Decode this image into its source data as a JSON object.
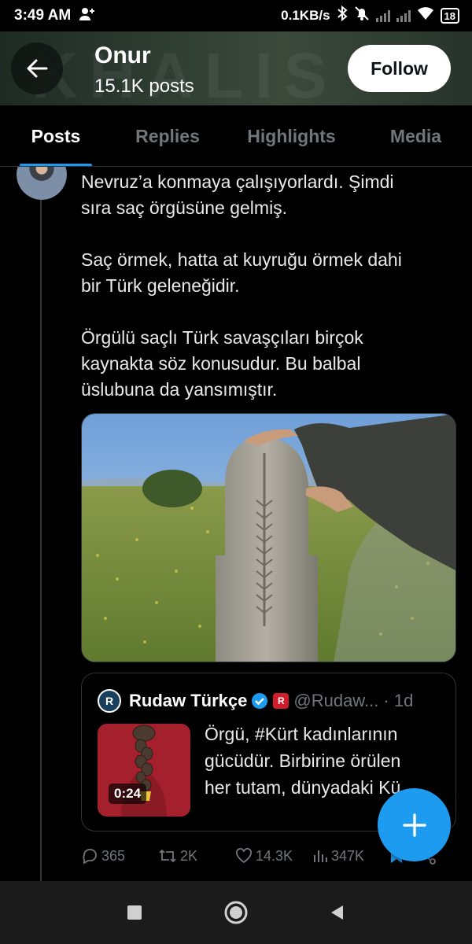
{
  "status_bar": {
    "time": "3:49 AM",
    "network_speed": "0.1KB/s",
    "battery": "18",
    "icons": [
      "person-add-icon",
      "bluetooth-icon",
      "mute-bell-icon",
      "signal-icon",
      "wifi-icon",
      "battery-icon"
    ]
  },
  "header": {
    "title": "Onur",
    "subtitle": "15.1K posts",
    "follow_label": "Follow",
    "banner_text": "KHALIS"
  },
  "tabs": [
    {
      "label": "Posts",
      "active": true
    },
    {
      "label": "Replies",
      "active": false
    },
    {
      "label": "Highlights",
      "active": false
    },
    {
      "label": "Media",
      "active": false
    }
  ],
  "tweet": {
    "paragraphs": [
      [
        "Nevruz’a konmaya çalışıyorlardı. Şimdi",
        "sıra saç örgüsüne gelmiş."
      ],
      [
        "Saç örmek, hatta at kuyruğu örmek dahi",
        "bir Türk geleneğidir."
      ],
      [
        "Örgülü saçlı Türk savaşçıları birçok",
        "kaynakta söz konusudur. Bu balbal",
        "üslubuna da yansımıştır."
      ]
    ]
  },
  "quote": {
    "name": "Rudaw Türkçe",
    "handle": "@Rudaw... · 1d",
    "logo_text": "R",
    "video_duration": "0:24",
    "text_lines": [
      "Örgü, #Kürt kadınlarının",
      "gücüdür. Birbirine örülen",
      "her tutam, dünyadaki Kü..."
    ]
  },
  "actions": {
    "replies": "365",
    "reposts": "2K",
    "likes": "14.3K",
    "views": "347K"
  },
  "colors": {
    "accent": "#1d9bf0",
    "background": "#000000",
    "secondary_text": "#71767b"
  }
}
